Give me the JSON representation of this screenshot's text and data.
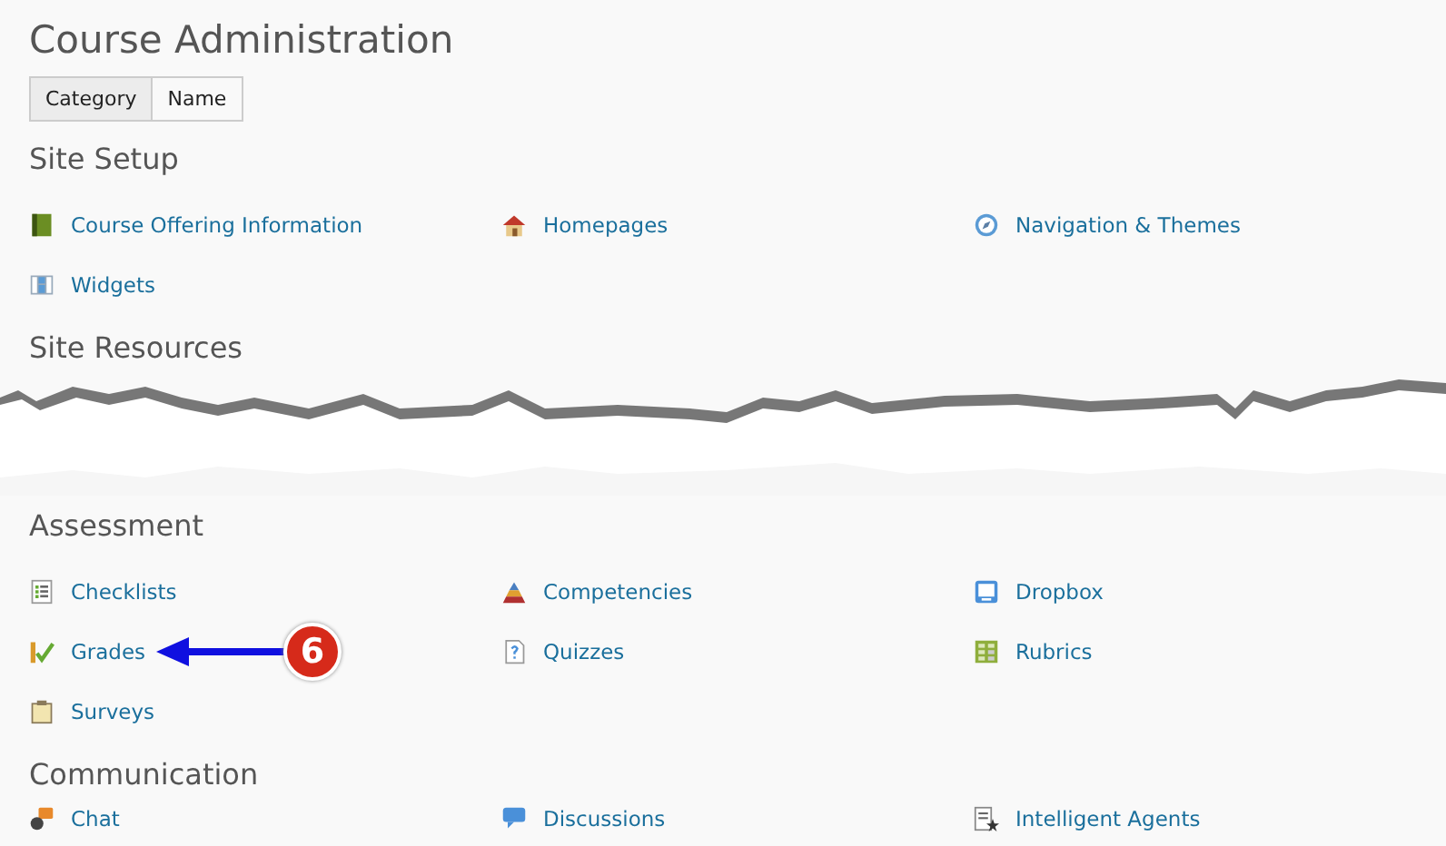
{
  "title": "Course Administration",
  "view_tabs": [
    {
      "label": "Category",
      "selected": true
    },
    {
      "label": "Name",
      "selected": false
    }
  ],
  "sections": [
    {
      "heading": "Site Setup",
      "items": [
        {
          "label": "Course Offering Information"
        },
        {
          "label": "Homepages"
        },
        {
          "label": "Navigation & Themes"
        },
        {
          "label": "Widgets"
        }
      ]
    },
    {
      "heading": "Site Resources",
      "torn": true
    },
    {
      "heading": "Assessment",
      "items": [
        {
          "label": "Checklists"
        },
        {
          "label": "Competencies"
        },
        {
          "label": "Dropbox"
        },
        {
          "label": "Grades"
        },
        {
          "label": "Quizzes"
        },
        {
          "label": "Rubrics"
        },
        {
          "label": "Surveys"
        }
      ]
    },
    {
      "heading": "Communication",
      "items": [
        {
          "label": "Chat"
        },
        {
          "label": "Discussions"
        },
        {
          "label": "Intelligent Agents"
        }
      ]
    }
  ],
  "callout": {
    "number": "6"
  }
}
